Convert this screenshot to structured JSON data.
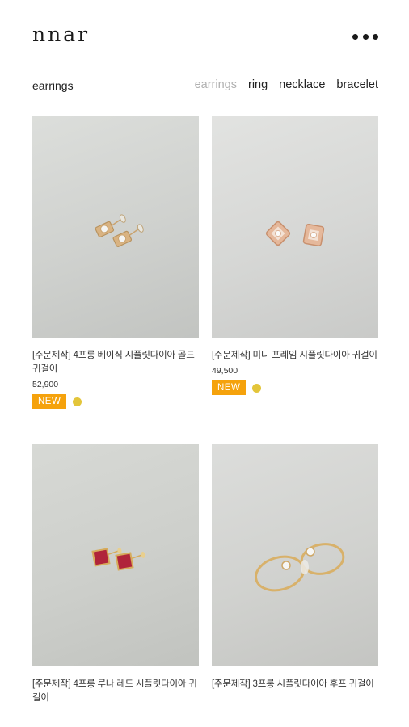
{
  "header": {
    "logo": "nnar",
    "more_icon": "more-dots-icon"
  },
  "category": {
    "title": "earrings",
    "tabs": [
      {
        "label": "earrings",
        "active": true
      },
      {
        "label": "ring",
        "active": false
      },
      {
        "label": "necklace",
        "active": false
      },
      {
        "label": "bracelet",
        "active": false
      }
    ]
  },
  "products": [
    {
      "name": "[주문제작] 4프롱 베이직 시플릿다이아 골드 귀걸이",
      "price": "52,900",
      "badge": "NEW",
      "color_swatch": "#e3c53a"
    },
    {
      "name": "[주문제작] 미니 프레임 시플릿다이아 귀걸이",
      "price": "49,500",
      "badge": "NEW",
      "color_swatch": "#e3c53a"
    },
    {
      "name": "[주문제작] 4프롱 루나 레드 시플릿다이아 귀걸이"
    },
    {
      "name": "[주문제작] 3프롱 시플릿다이아 후프 귀걸이"
    }
  ],
  "colors": {
    "badge_new": "#f5a20c",
    "swatch_gold": "#e3c53a",
    "tab_active": "#b0b0b0"
  }
}
